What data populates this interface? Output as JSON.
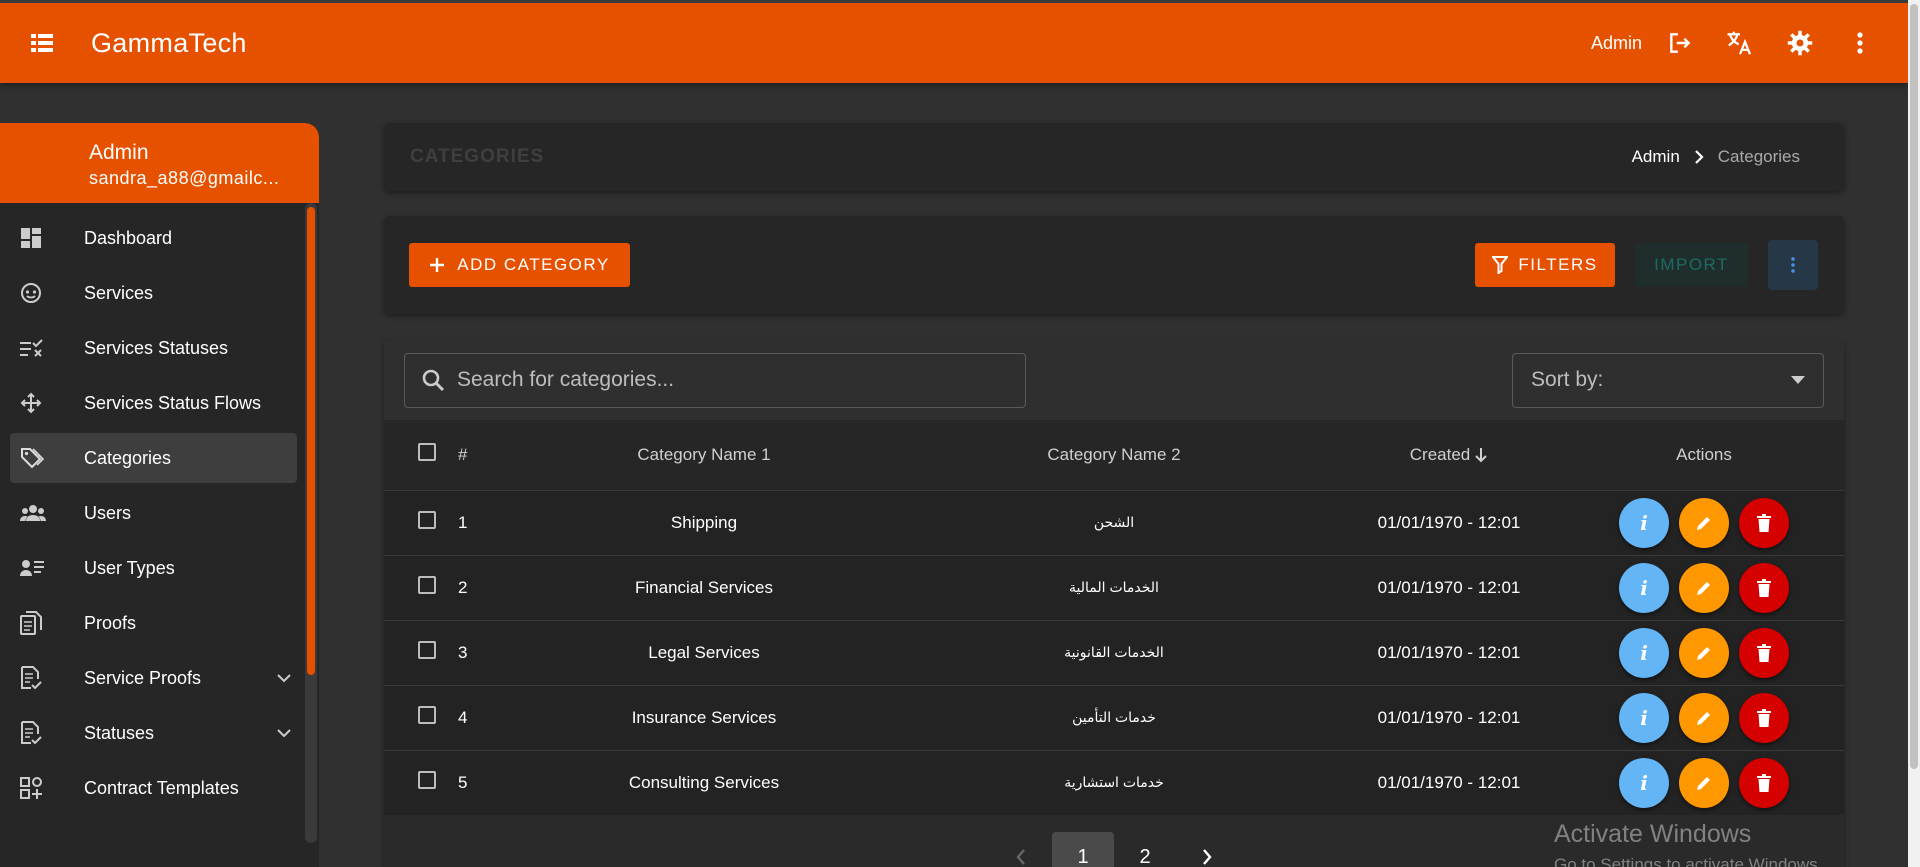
{
  "header": {
    "brand": "GammaTech",
    "user": "Admin",
    "icons": [
      "menu-icon",
      "logout-icon",
      "translate-icon",
      "settings-icon",
      "more-vert-icon"
    ]
  },
  "sidebar": {
    "user_name": "Admin",
    "user_email": "sandra_a88@gmailc...",
    "items": [
      {
        "label": "Dashboard",
        "icon": "dashboard-icon"
      },
      {
        "label": "Services",
        "icon": "services-icon"
      },
      {
        "label": "Services Statuses",
        "icon": "statuses-list-icon"
      },
      {
        "label": "Services Status Flows",
        "icon": "flow-icon"
      },
      {
        "label": "Categories",
        "icon": "tags-icon",
        "active": true
      },
      {
        "label": "Users",
        "icon": "users-icon"
      },
      {
        "label": "User Types",
        "icon": "user-types-icon"
      },
      {
        "label": "Proofs",
        "icon": "proofs-icon"
      },
      {
        "label": "Service Proofs",
        "icon": "service-proofs-icon",
        "expandable": true
      },
      {
        "label": "Statuses",
        "icon": "statuses-icon",
        "expandable": true
      },
      {
        "label": "Contract Templates",
        "icon": "templates-icon"
      }
    ]
  },
  "page": {
    "title": "CATEGORIES",
    "breadcrumb": [
      "Admin",
      "Categories"
    ]
  },
  "actions": {
    "add_label": "ADD CATEGORY",
    "filters_label": "FILTERS",
    "import_label": "IMPORT"
  },
  "search": {
    "placeholder": "Search for categories..."
  },
  "sort": {
    "label": "Sort by:"
  },
  "table": {
    "columns": [
      "#",
      "Category Name 1",
      "Category Name 2",
      "Created",
      "Actions"
    ],
    "rows": [
      {
        "num": "1",
        "name1": "Shipping",
        "name2": "الشحن",
        "created": "01/01/1970 - 12:01"
      },
      {
        "num": "2",
        "name1": "Financial Services",
        "name2": "الخدمات المالية",
        "created": "01/01/1970 - 12:01"
      },
      {
        "num": "3",
        "name1": "Legal Services",
        "name2": "الخدمات القانونية",
        "created": "01/01/1970 - 12:01"
      },
      {
        "num": "4",
        "name1": "Insurance Services",
        "name2": "خدمات التأمين",
        "created": "01/01/1970 - 12:01"
      },
      {
        "num": "5",
        "name1": "Consulting Services",
        "name2": "خدمات استشارية",
        "created": "01/01/1970 - 12:01"
      }
    ]
  },
  "pagination": {
    "pages": [
      "1",
      "2"
    ],
    "current": "1"
  },
  "watermark": {
    "line1": "Activate Windows",
    "line2": "Go to Settings to activate Windows."
  },
  "colors": {
    "accent": "#e65100",
    "info": "#64b5f6",
    "edit": "#ff9800",
    "delete": "#d50000"
  }
}
